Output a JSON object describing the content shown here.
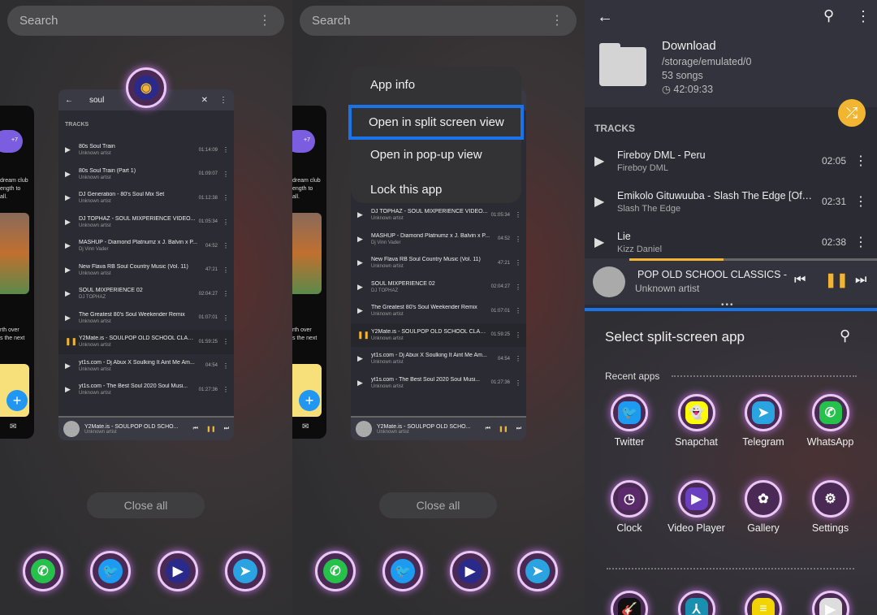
{
  "recents": {
    "search_placeholder": "Search",
    "close_all": "Close all"
  },
  "side_card": {
    "lines": [
      "dream club",
      "ength to",
      "all.",
      "rth over",
      "s the next"
    ],
    "badge": "+7"
  },
  "music_card": {
    "search_query": "soul",
    "section": "TRACKS",
    "tracks": [
      {
        "title": "80s Soul Train",
        "artist": "Unknown artist",
        "duration": "01:14:09"
      },
      {
        "title": "80s Soul Train (Part 1)",
        "artist": "Unknown artist",
        "duration": "01:09:07"
      },
      {
        "title": "DJ Generation - 80's Soul Mix Set",
        "artist": "Unknown artist",
        "duration": "01:12:38"
      },
      {
        "title": "DJ TOPHAZ - SOUL MIXPERIENCE VIDEO...",
        "artist": "Unknown artist",
        "duration": "01:05:34"
      },
      {
        "title": "MASHUP - Diamond Platnumz x J. Balvin x P...",
        "artist": "Dj Vinn Vader",
        "duration": "04:52"
      },
      {
        "title": "New Flava RB Soul  Country Music (Vol. 11)",
        "artist": "Unknown artist",
        "duration": "47:21"
      },
      {
        "title": "SOUL MIXPERIENCE 02",
        "artist": "DJ TOPHAZ",
        "duration": "02:04:27"
      },
      {
        "title": "The Greatest 80's Soul Weekender Remix",
        "artist": "Unknown artist",
        "duration": "01:07:01"
      },
      {
        "title": "Y2Mate.is - SOULPOP OLD SCHOOL CLAS...",
        "artist": "Unknown artist",
        "duration": "01:59:25",
        "playing": true
      },
      {
        "title": "yt1s.com - Dj Abux X Soulking  It Aint Me Am...",
        "artist": "Unknown artist",
        "duration": "04:54"
      },
      {
        "title": "yt1s.com - The Best Soul 2020  Soul Musi...",
        "artist": "Unknown artist",
        "duration": "01:27:36"
      }
    ],
    "now_playing": {
      "title": "Y2Mate.is - SOULPOP OLD SCHO...",
      "artist": "Unknown artist"
    }
  },
  "context_menu": {
    "items": [
      "App info",
      "Open in split screen view",
      "Open in pop-up view",
      "Lock this app"
    ],
    "highlighted": 1
  },
  "dock": [
    {
      "name": "WhatsApp",
      "color": "#25c14a",
      "glyph": "✆"
    },
    {
      "name": "Twitter",
      "color": "#1d9bf0",
      "glyph": "🐦"
    },
    {
      "name": "Music Player",
      "color": "#2a2a8a",
      "glyph": "▶"
    },
    {
      "name": "Telegram",
      "color": "#2aa3e0",
      "glyph": "➤"
    }
  ],
  "folder": {
    "name": "Download",
    "path": "/storage/emulated/0",
    "songs": "53 songs",
    "duration": "42:09:33",
    "section": "TRACKS",
    "tracks": [
      {
        "title": "Fireboy DML - Peru",
        "artist": "Fireboy DML",
        "duration": "02:05"
      },
      {
        "title": "Emikolo Gituwuuba - Slash The Edge [Official...",
        "artist": "Slash The Edge",
        "duration": "02:31"
      },
      {
        "title": "Lie",
        "artist": "Kizz Daniel",
        "duration": "02:38"
      }
    ],
    "now_playing": {
      "title": "POP OLD SCHOOL CLASSICS - DJ",
      "artist": "Unknown artist",
      "progress": 0.38
    },
    "accent": "#f2b531"
  },
  "split": {
    "title": "Select split-screen app",
    "recent_label": "Recent apps",
    "apps": [
      {
        "name": "Twitter",
        "color": "#1d9bf0",
        "glyph": "🐦"
      },
      {
        "name": "Snapchat",
        "color": "#fffc00",
        "glyph": "👻"
      },
      {
        "name": "Telegram",
        "color": "#2aa3e0",
        "glyph": "➤"
      },
      {
        "name": "WhatsApp",
        "color": "#25c14a",
        "glyph": "✆"
      },
      {
        "name": "Clock",
        "color": "#5a2a6a",
        "glyph": "◷"
      },
      {
        "name": "Video Player",
        "color": "#6a3fc0",
        "glyph": "▶"
      },
      {
        "name": "Gallery",
        "color": "#4a2a55",
        "glyph": "✿"
      },
      {
        "name": "Settings",
        "color": "#4a2a55",
        "glyph": "⚙"
      }
    ],
    "more_apps": [
      {
        "color": "#111",
        "glyph": "🎸"
      },
      {
        "color": "#1a8fb0",
        "glyph": "⅄"
      },
      {
        "color": "#f2d500",
        "glyph": "≡"
      },
      {
        "color": "#ddd",
        "glyph": "▶"
      }
    ]
  },
  "colors": {
    "highlight": "#1a73e8",
    "divider": "#1a73e8"
  }
}
